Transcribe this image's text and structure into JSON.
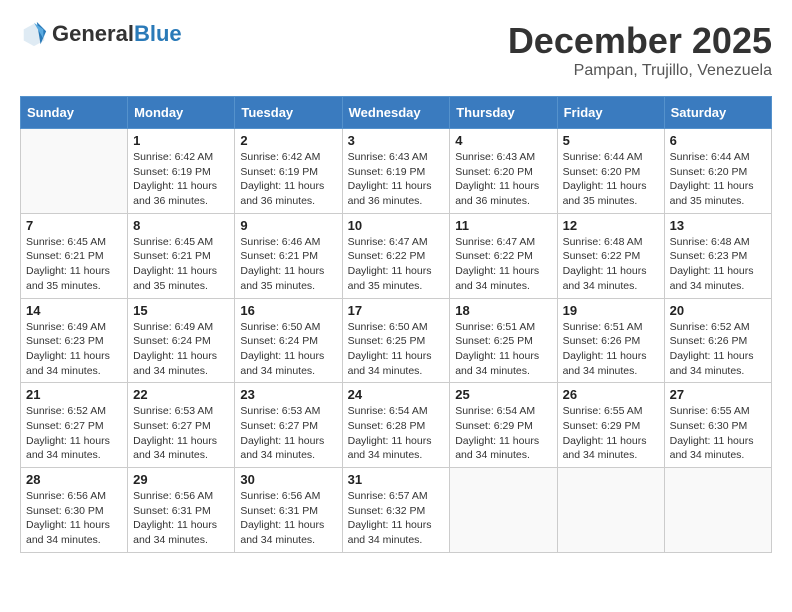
{
  "logo": {
    "general": "General",
    "blue": "Blue"
  },
  "title": "December 2025",
  "location": "Pampan, Trujillo, Venezuela",
  "days_of_week": [
    "Sunday",
    "Monday",
    "Tuesday",
    "Wednesday",
    "Thursday",
    "Friday",
    "Saturday"
  ],
  "weeks": [
    [
      {
        "day": "",
        "sunrise": "",
        "sunset": "",
        "daylight": ""
      },
      {
        "day": "1",
        "sunrise": "Sunrise: 6:42 AM",
        "sunset": "Sunset: 6:19 PM",
        "daylight": "Daylight: 11 hours and 36 minutes."
      },
      {
        "day": "2",
        "sunrise": "Sunrise: 6:42 AM",
        "sunset": "Sunset: 6:19 PM",
        "daylight": "Daylight: 11 hours and 36 minutes."
      },
      {
        "day": "3",
        "sunrise": "Sunrise: 6:43 AM",
        "sunset": "Sunset: 6:19 PM",
        "daylight": "Daylight: 11 hours and 36 minutes."
      },
      {
        "day": "4",
        "sunrise": "Sunrise: 6:43 AM",
        "sunset": "Sunset: 6:20 PM",
        "daylight": "Daylight: 11 hours and 36 minutes."
      },
      {
        "day": "5",
        "sunrise": "Sunrise: 6:44 AM",
        "sunset": "Sunset: 6:20 PM",
        "daylight": "Daylight: 11 hours and 35 minutes."
      },
      {
        "day": "6",
        "sunrise": "Sunrise: 6:44 AM",
        "sunset": "Sunset: 6:20 PM",
        "daylight": "Daylight: 11 hours and 35 minutes."
      }
    ],
    [
      {
        "day": "7",
        "sunrise": "Sunrise: 6:45 AM",
        "sunset": "Sunset: 6:21 PM",
        "daylight": "Daylight: 11 hours and 35 minutes."
      },
      {
        "day": "8",
        "sunrise": "Sunrise: 6:45 AM",
        "sunset": "Sunset: 6:21 PM",
        "daylight": "Daylight: 11 hours and 35 minutes."
      },
      {
        "day": "9",
        "sunrise": "Sunrise: 6:46 AM",
        "sunset": "Sunset: 6:21 PM",
        "daylight": "Daylight: 11 hours and 35 minutes."
      },
      {
        "day": "10",
        "sunrise": "Sunrise: 6:47 AM",
        "sunset": "Sunset: 6:22 PM",
        "daylight": "Daylight: 11 hours and 35 minutes."
      },
      {
        "day": "11",
        "sunrise": "Sunrise: 6:47 AM",
        "sunset": "Sunset: 6:22 PM",
        "daylight": "Daylight: 11 hours and 34 minutes."
      },
      {
        "day": "12",
        "sunrise": "Sunrise: 6:48 AM",
        "sunset": "Sunset: 6:22 PM",
        "daylight": "Daylight: 11 hours and 34 minutes."
      },
      {
        "day": "13",
        "sunrise": "Sunrise: 6:48 AM",
        "sunset": "Sunset: 6:23 PM",
        "daylight": "Daylight: 11 hours and 34 minutes."
      }
    ],
    [
      {
        "day": "14",
        "sunrise": "Sunrise: 6:49 AM",
        "sunset": "Sunset: 6:23 PM",
        "daylight": "Daylight: 11 hours and 34 minutes."
      },
      {
        "day": "15",
        "sunrise": "Sunrise: 6:49 AM",
        "sunset": "Sunset: 6:24 PM",
        "daylight": "Daylight: 11 hours and 34 minutes."
      },
      {
        "day": "16",
        "sunrise": "Sunrise: 6:50 AM",
        "sunset": "Sunset: 6:24 PM",
        "daylight": "Daylight: 11 hours and 34 minutes."
      },
      {
        "day": "17",
        "sunrise": "Sunrise: 6:50 AM",
        "sunset": "Sunset: 6:25 PM",
        "daylight": "Daylight: 11 hours and 34 minutes."
      },
      {
        "day": "18",
        "sunrise": "Sunrise: 6:51 AM",
        "sunset": "Sunset: 6:25 PM",
        "daylight": "Daylight: 11 hours and 34 minutes."
      },
      {
        "day": "19",
        "sunrise": "Sunrise: 6:51 AM",
        "sunset": "Sunset: 6:26 PM",
        "daylight": "Daylight: 11 hours and 34 minutes."
      },
      {
        "day": "20",
        "sunrise": "Sunrise: 6:52 AM",
        "sunset": "Sunset: 6:26 PM",
        "daylight": "Daylight: 11 hours and 34 minutes."
      }
    ],
    [
      {
        "day": "21",
        "sunrise": "Sunrise: 6:52 AM",
        "sunset": "Sunset: 6:27 PM",
        "daylight": "Daylight: 11 hours and 34 minutes."
      },
      {
        "day": "22",
        "sunrise": "Sunrise: 6:53 AM",
        "sunset": "Sunset: 6:27 PM",
        "daylight": "Daylight: 11 hours and 34 minutes."
      },
      {
        "day": "23",
        "sunrise": "Sunrise: 6:53 AM",
        "sunset": "Sunset: 6:27 PM",
        "daylight": "Daylight: 11 hours and 34 minutes."
      },
      {
        "day": "24",
        "sunrise": "Sunrise: 6:54 AM",
        "sunset": "Sunset: 6:28 PM",
        "daylight": "Daylight: 11 hours and 34 minutes."
      },
      {
        "day": "25",
        "sunrise": "Sunrise: 6:54 AM",
        "sunset": "Sunset: 6:29 PM",
        "daylight": "Daylight: 11 hours and 34 minutes."
      },
      {
        "day": "26",
        "sunrise": "Sunrise: 6:55 AM",
        "sunset": "Sunset: 6:29 PM",
        "daylight": "Daylight: 11 hours and 34 minutes."
      },
      {
        "day": "27",
        "sunrise": "Sunrise: 6:55 AM",
        "sunset": "Sunset: 6:30 PM",
        "daylight": "Daylight: 11 hours and 34 minutes."
      }
    ],
    [
      {
        "day": "28",
        "sunrise": "Sunrise: 6:56 AM",
        "sunset": "Sunset: 6:30 PM",
        "daylight": "Daylight: 11 hours and 34 minutes."
      },
      {
        "day": "29",
        "sunrise": "Sunrise: 6:56 AM",
        "sunset": "Sunset: 6:31 PM",
        "daylight": "Daylight: 11 hours and 34 minutes."
      },
      {
        "day": "30",
        "sunrise": "Sunrise: 6:56 AM",
        "sunset": "Sunset: 6:31 PM",
        "daylight": "Daylight: 11 hours and 34 minutes."
      },
      {
        "day": "31",
        "sunrise": "Sunrise: 6:57 AM",
        "sunset": "Sunset: 6:32 PM",
        "daylight": "Daylight: 11 hours and 34 minutes."
      },
      {
        "day": "",
        "sunrise": "",
        "sunset": "",
        "daylight": ""
      },
      {
        "day": "",
        "sunrise": "",
        "sunset": "",
        "daylight": ""
      },
      {
        "day": "",
        "sunrise": "",
        "sunset": "",
        "daylight": ""
      }
    ]
  ]
}
